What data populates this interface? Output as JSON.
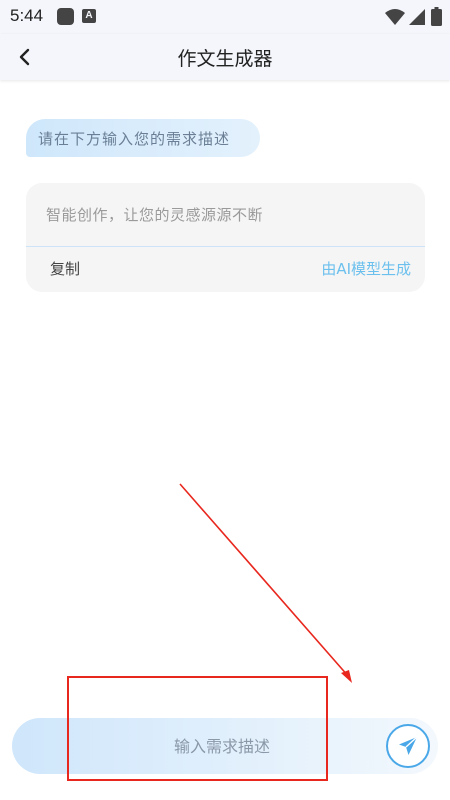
{
  "status_bar": {
    "time": "5:44",
    "app_icon_letter": "A"
  },
  "header": {
    "title": "作文生成器",
    "back_icon": "chevron-left-icon"
  },
  "chat": {
    "prompt_bubble": "请在下方输入您的需求描述",
    "result_card": {
      "text": "智能创作，让您的灵感源源不断",
      "copy_label": "复制",
      "credit": "由AI模型生成"
    }
  },
  "input_bar": {
    "placeholder": "输入需求描述",
    "value": "",
    "send_icon": "send-icon"
  },
  "colors": {
    "accent": "#4aa8e8",
    "credit": "#6cc0ee",
    "annotation": "#e8271e"
  }
}
